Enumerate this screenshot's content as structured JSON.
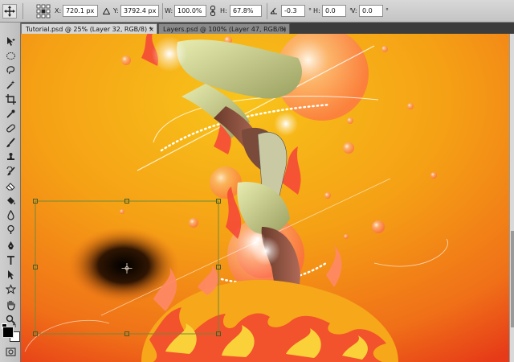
{
  "options_bar": {
    "x_label": "X:",
    "x_value": "720.1 px",
    "y_label": "Y:",
    "y_value": "3792.4 px",
    "w_label": "W:",
    "w_value": "100.0%",
    "h_label": "H:",
    "h_value": "67.8%",
    "rotate_value": "-0.3",
    "hskew_label": "H:",
    "hskew_value": "0.0",
    "vskew_label": "V:",
    "vskew_value": "0.0"
  },
  "tabs": [
    {
      "label": "Tutorial.psd @ 25% (Layer 32, RGB/8) *",
      "close": "×",
      "active": true
    },
    {
      "label": "Layers.psd @ 100% (Layer 47, RGB/8)",
      "close": "×",
      "active": false
    }
  ],
  "tools": [
    "move",
    "marquee",
    "lasso",
    "magic-wand",
    "crop",
    "eyedropper",
    "healing-brush",
    "brush",
    "clone-stamp",
    "history-brush",
    "eraser",
    "paint-bucket",
    "blur",
    "dodge",
    "pen",
    "type",
    "path-selection",
    "shape",
    "hand",
    "zoom",
    "foreground-background-colors",
    "quick-mask"
  ],
  "colors": {
    "bg_top": "#f5a516",
    "bg_mid": "#f58a18",
    "bg_bottom": "#ea3418",
    "transform_box": "#7a8a3a",
    "foreground": "#000000",
    "background": "#ffffff"
  },
  "artwork": {
    "subject": "jumping-figure-with-fire-and-bubbles",
    "selection": "free-transform-bounding-box"
  }
}
